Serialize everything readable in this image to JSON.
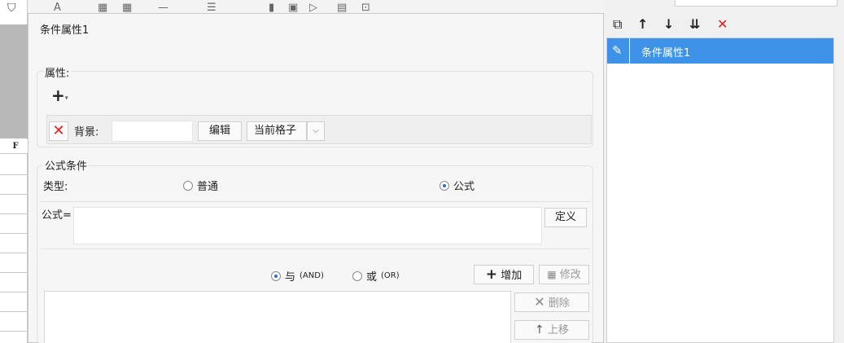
{
  "dialog": {
    "title": "条件属性1"
  },
  "attributes": {
    "section_label": "属性:",
    "add_icon": "plus-icon",
    "remove_icon": "red-x-icon",
    "background_label": "背景:",
    "background_value": "",
    "edit_button": "编辑",
    "scope_select": "当前格子",
    "scope_arrow": "chevron-down-icon"
  },
  "formula_condition": {
    "section_label": "公式条件",
    "type_label": "类型:",
    "type_options": [
      {
        "label": "普通",
        "selected": false
      },
      {
        "label": "公式",
        "selected": true
      }
    ],
    "formula_label": "公式=",
    "formula_value": "",
    "define_button": "定义",
    "logic_options": [
      {
        "label": "与",
        "suffix": "(AND)",
        "selected": true
      },
      {
        "label": "或",
        "suffix": "(OR)",
        "selected": false
      }
    ],
    "add_button": "增加",
    "modify_button": "修改",
    "delete_button": "删除",
    "move_up_button": "上移"
  },
  "right_panel": {
    "tools": [
      "copy-icon",
      "arrow-up-icon",
      "arrow-down-icon",
      "move-bottom-icon",
      "delete-icon"
    ],
    "items": [
      {
        "label": "条件属性1",
        "icon": "pencil-icon",
        "selected": true
      }
    ]
  },
  "sheet": {
    "column_header": "F"
  },
  "colors": {
    "accent": "#3d93e8",
    "danger": "#e02020",
    "radio": "#2a6bd6"
  }
}
